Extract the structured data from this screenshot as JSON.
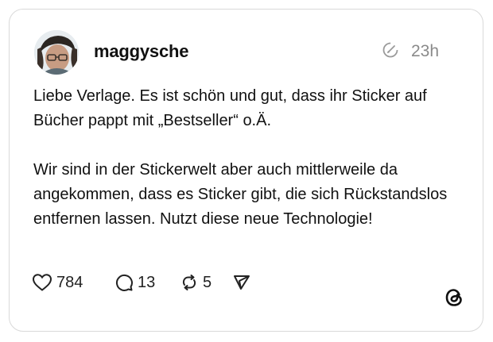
{
  "post": {
    "username": "maggysche",
    "timestamp": "23h",
    "paragraphs": [
      "Liebe Verlage. Es ist schön und gut, dass  ihr Sticker auf Bücher pappt mit „Bestseller“ o.Ä.",
      "Wir sind in der Stickerwelt aber auch mittlerweile da angekommen, dass es Sticker gibt, die sich Rückstandslos entfernen lassen. Nutzt diese neue Technologie!"
    ]
  },
  "actions": {
    "likes": "784",
    "replies": "13",
    "reposts": "5"
  },
  "icons": {
    "like": "heart-icon",
    "reply": "speech-bubble-icon",
    "repost": "repost-icon",
    "share": "send-icon",
    "edited": "edited-pencil-icon",
    "brand": "threads-logo-icon"
  }
}
